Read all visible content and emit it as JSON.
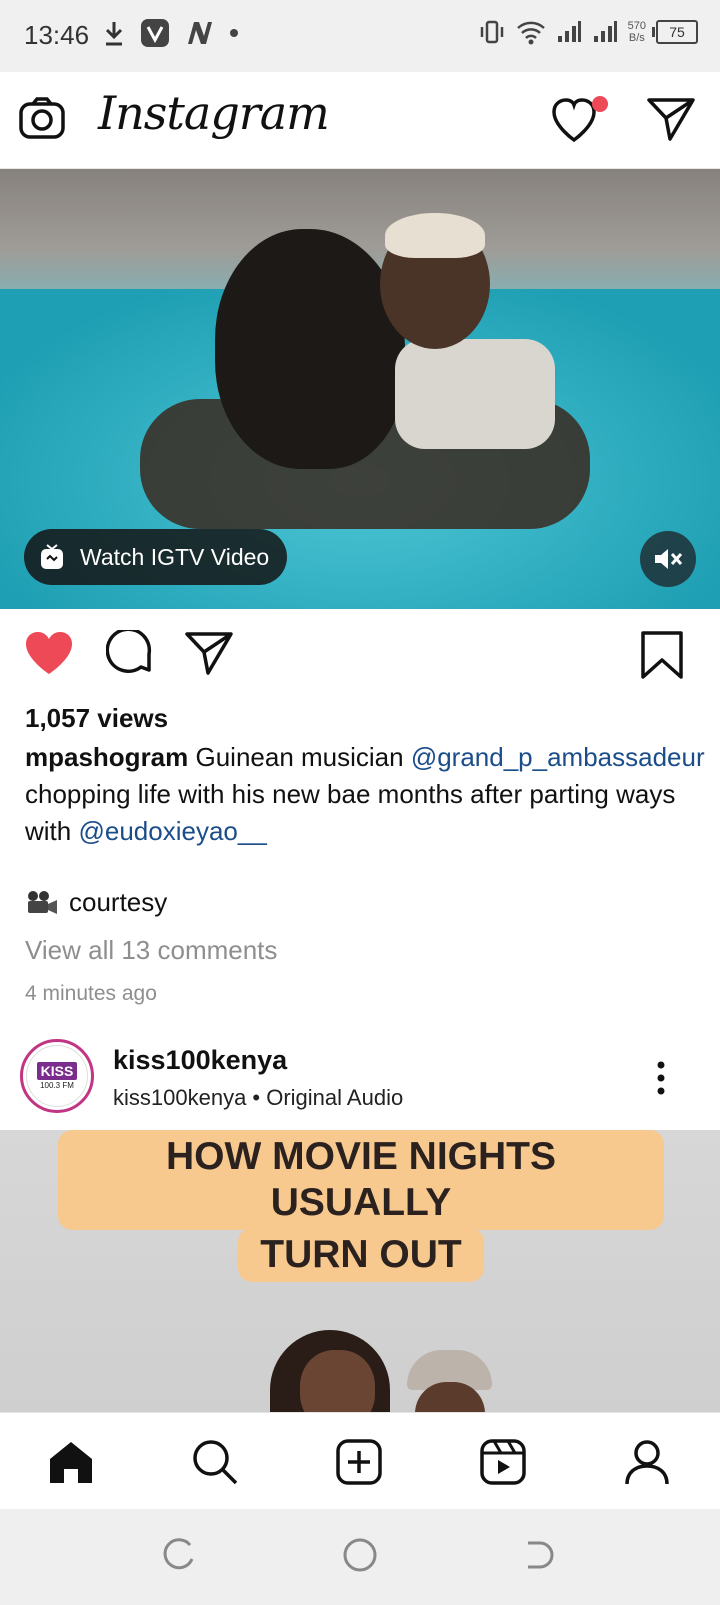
{
  "status_bar": {
    "time": "13:46",
    "net_rate_top": "570",
    "net_rate_bottom": "B/s",
    "battery": "75"
  },
  "header": {
    "logo": "Instagram"
  },
  "post1": {
    "igtv_label": "Watch IGTV Video",
    "views": "1,057 views",
    "username": "mpashogram",
    "caption_text_1": " Guinean musician ",
    "mention_1": "@grand_p_ambassadeur",
    "caption_text_2": " chopping life with his new bae months after parting ways with ",
    "mention_2": "@eudoxieyao__",
    "courtesy": "courtesy",
    "view_comments": "View all 13 comments",
    "time_ago": "4 minutes ago"
  },
  "post2": {
    "avatar_text_top": "KISS",
    "avatar_text_bottom": "100.3 FM",
    "username": "kiss100kenya",
    "audio_line": "kiss100kenya • Original Audio",
    "banner_line_1": "HOW MOVIE NIGHTS USUALLY",
    "banner_line_2": "TURN OUT"
  },
  "colors": {
    "like_active": "#ed4956",
    "mention": "#1b4d8a",
    "notification_dot": "#ed4956"
  }
}
